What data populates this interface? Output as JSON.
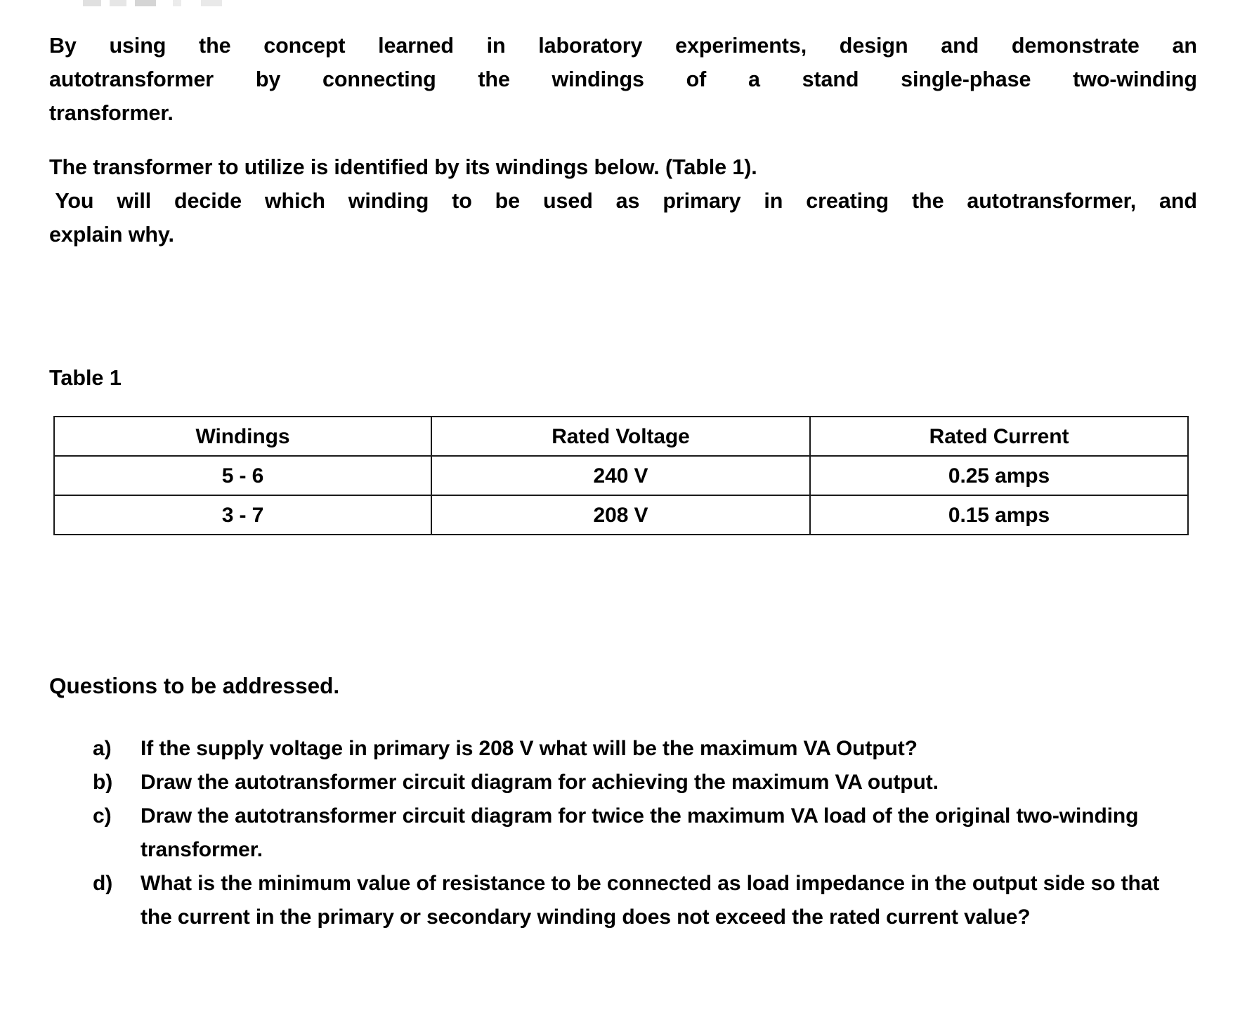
{
  "document": {
    "paragraphs": {
      "intro": {
        "line1": "By using the concept learned in laboratory experiments, design and demonstrate an",
        "line2": "autotransformer by connecting the windings of a stand single-phase two-winding",
        "line3": "transformer."
      },
      "table_reference": {
        "line1": "The transformer to utilize is identified by its windings below. (Table 1).",
        "line2": " You will decide which winding to be used as primary in creating the autotransformer, and",
        "line3": "explain why."
      }
    },
    "table_label": "Table 1",
    "table": {
      "headers": [
        "Windings",
        "Rated Voltage",
        "Rated Current"
      ],
      "rows": [
        [
          "5 - 6",
          "240 V",
          "0.25 amps"
        ],
        [
          "3 - 7",
          "208 V",
          "0.15 amps"
        ]
      ]
    },
    "questions_heading": "Questions to be addressed.",
    "questions": [
      {
        "marker": "a)",
        "text": "If the supply voltage in primary is 208 V what will be the maximum VA Output?"
      },
      {
        "marker": "b)",
        "text": "Draw the autotransformer circuit diagram for achieving the maximum VA output."
      },
      {
        "marker": "c)",
        "text": "Draw the autotransformer circuit diagram for twice the maximum VA load of the original two-winding transformer."
      },
      {
        "marker": "d)",
        "text": "What is the minimum value of resistance to be connected as load impedance in the output side so that the current in the primary or secondary winding does not exceed the rated current value?"
      }
    ]
  }
}
